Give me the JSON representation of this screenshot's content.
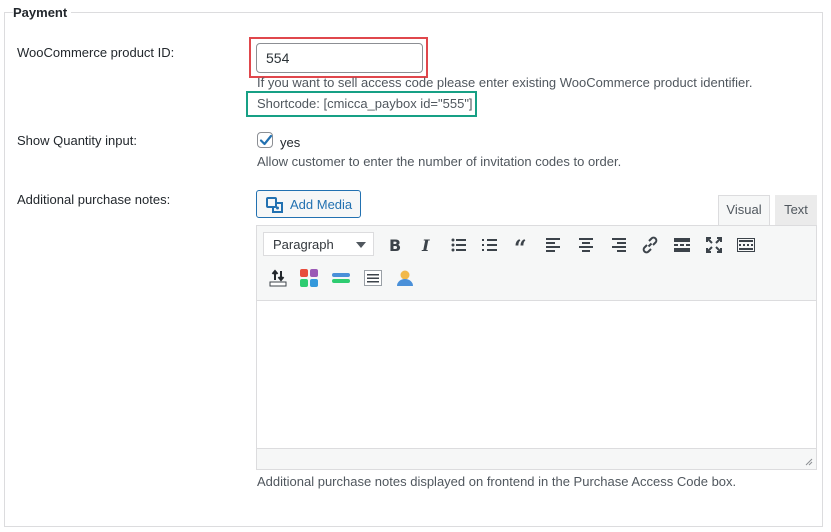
{
  "section": {
    "legend": "Payment"
  },
  "product_id": {
    "label": "WooCommerce product ID:",
    "value": "554",
    "description": "If you want to sell access code please enter existing WooCommerce product identifier.",
    "shortcode": "Shortcode: [cmicca_paybox id=\"555\"]"
  },
  "quantity": {
    "label": "Show Quantity input:",
    "checked": true,
    "checkbox_label": "yes",
    "description": "Allow customer to enter the number of invitation codes to order."
  },
  "notes": {
    "label": "Additional purchase notes:",
    "add_media_label": "Add Media",
    "tabs": [
      "Visual",
      "Text"
    ],
    "active_tab": "Visual",
    "format_value": "Paragraph",
    "description": "Additional purchase notes displayed on frontend in the Purchase Access Code box."
  },
  "toolbar_icons": [
    "bold-icon",
    "italic-icon",
    "bulleted-list-icon",
    "numbered-list-icon",
    "blockquote-icon",
    "align-left-icon",
    "align-center-icon",
    "align-right-icon",
    "link-icon",
    "read-more-icon",
    "fullscreen-icon",
    "toolbar-toggle-icon",
    "sort-icon",
    "color-grid-icon",
    "divider-icon",
    "list-block-icon",
    "user-icon"
  ],
  "colors": {
    "highlight_red": "#e0474c",
    "highlight_teal": "#17a085",
    "accent_blue": "#2271b1"
  }
}
